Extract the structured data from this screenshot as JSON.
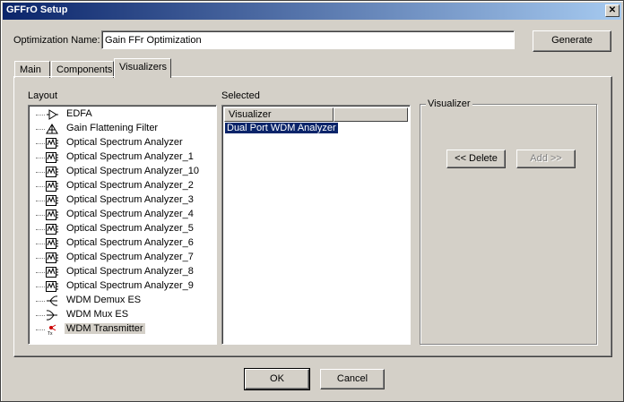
{
  "window": {
    "title": "GFFrO Setup",
    "close_label": "✕"
  },
  "optimization": {
    "label": "Optimization Name:",
    "value": "Gain FFr Optimization"
  },
  "buttons": {
    "generate": "Generate",
    "ok": "OK",
    "cancel": "Cancel",
    "delete": "<< Delete",
    "add": "Add >>"
  },
  "tabs": [
    {
      "label": "Main"
    },
    {
      "label": "Components"
    },
    {
      "label": "Visualizers"
    }
  ],
  "layout": {
    "label": "Layout",
    "items": [
      {
        "label": "EDFA",
        "icon": "amplifier-icon"
      },
      {
        "label": "Gain Flattening Filter",
        "icon": "filter-icon"
      },
      {
        "label": "Optical Spectrum Analyzer",
        "icon": "analyzer-icon"
      },
      {
        "label": "Optical Spectrum Analyzer_1",
        "icon": "analyzer-icon"
      },
      {
        "label": "Optical Spectrum Analyzer_10",
        "icon": "analyzer-icon"
      },
      {
        "label": "Optical Spectrum Analyzer_2",
        "icon": "analyzer-icon"
      },
      {
        "label": "Optical Spectrum Analyzer_3",
        "icon": "analyzer-icon"
      },
      {
        "label": "Optical Spectrum Analyzer_4",
        "icon": "analyzer-icon"
      },
      {
        "label": "Optical Spectrum Analyzer_5",
        "icon": "analyzer-icon"
      },
      {
        "label": "Optical Spectrum Analyzer_6",
        "icon": "analyzer-icon"
      },
      {
        "label": "Optical Spectrum Analyzer_7",
        "icon": "analyzer-icon"
      },
      {
        "label": "Optical Spectrum Analyzer_8",
        "icon": "analyzer-icon"
      },
      {
        "label": "Optical Spectrum Analyzer_9",
        "icon": "analyzer-icon"
      },
      {
        "label": "WDM Demux ES",
        "icon": "demux-icon"
      },
      {
        "label": "WDM Mux ES",
        "icon": "mux-icon"
      },
      {
        "label": "WDM Transmitter",
        "icon": "transmitter-icon"
      }
    ],
    "selected_index": 15
  },
  "selected": {
    "label": "Selected",
    "column_header": "Visualizer",
    "items": [
      {
        "label": "Dual Port WDM Analyzer"
      }
    ]
  },
  "visualizer_group": {
    "label": "Visualizer"
  },
  "colors": {
    "title_gradient_start": "#0a246a",
    "title_gradient_end": "#a6caf0",
    "selection": "#0a246a",
    "face": "#d4d0c8"
  }
}
